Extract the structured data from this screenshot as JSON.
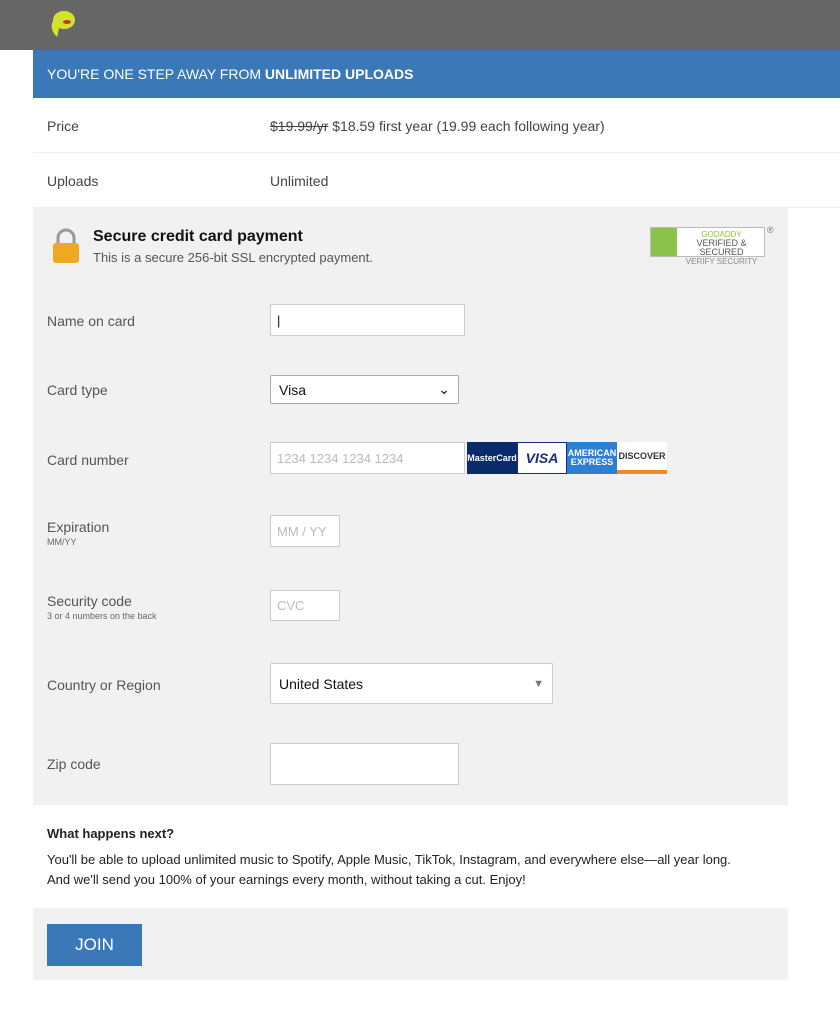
{
  "banner": {
    "prefix": "YOU'RE ONE STEP AWAY FROM ",
    "bold": "UNLIMITED UPLOADS"
  },
  "summary": [
    {
      "label": "Price",
      "old_price": "$19.99/yr",
      "value": " $18.59 first year (19.99 each following year)"
    },
    {
      "label": "Uploads",
      "value": "Unlimited"
    }
  ],
  "secure": {
    "title": "Secure credit card payment",
    "subtitle": "This is a secure 256-bit SSL encrypted payment.",
    "badge": {
      "brand": "GODADDY",
      "main": "VERIFIED & SECURED",
      "sub": "VERIFY SECURITY",
      "reg": "®"
    }
  },
  "form": {
    "name_label": "Name on card",
    "name_value": "",
    "card_type_label": "Card type",
    "card_type_value": "Visa",
    "card_number_label": "Card number",
    "card_number_placeholder": "1234 1234 1234 1234",
    "cards": [
      "MasterCard",
      "VISA",
      "AMERICAN EXPRESS",
      "DISCOVER"
    ],
    "expiration_label": "Expiration",
    "expiration_sub": "MM/YY",
    "expiration_placeholder": "MM / YY",
    "security_label": "Security code",
    "security_sub": "3 or 4 numbers on the back",
    "security_placeholder": "CVC",
    "country_label": "Country or Region",
    "country_value": "United States",
    "zip_label": "Zip code",
    "zip_value": ""
  },
  "next": {
    "title": "What happens next?",
    "line1": "You'll be able to upload unlimited music to Spotify, Apple Music, TikTok, Instagram, and everywhere else—all year long.",
    "line2": "And we'll send you 100% of your earnings every month, without taking a cut. Enjoy!"
  },
  "join_label": "JOIN",
  "colors": {
    "brand_blue": "#3a78b8",
    "header_gray": "#666666",
    "panel_gray": "#f1f1f1"
  }
}
